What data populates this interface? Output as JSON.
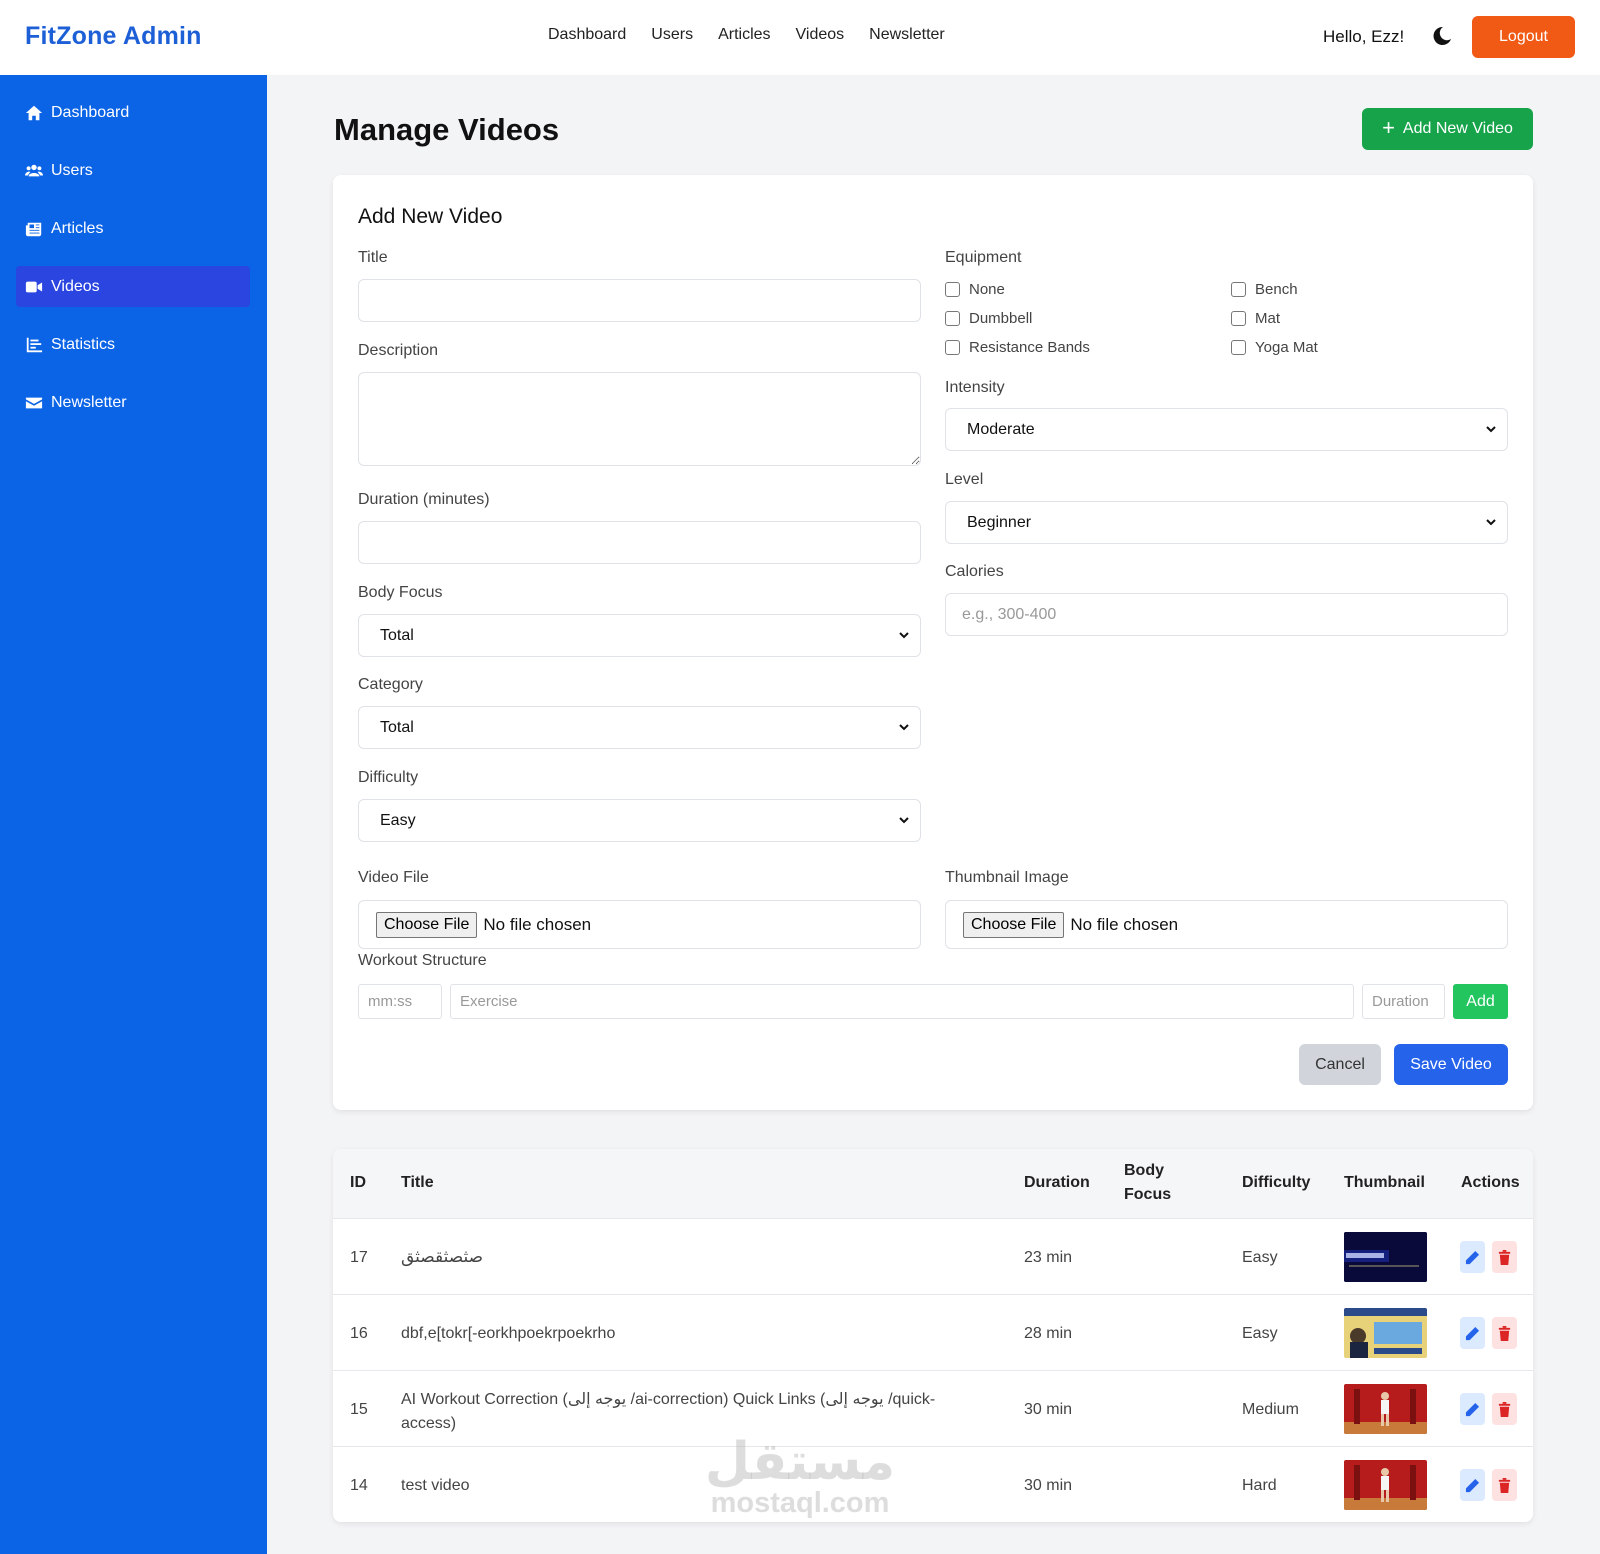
{
  "brand": "FitZone Admin",
  "topnav": [
    "Dashboard",
    "Users",
    "Articles",
    "Videos",
    "Newsletter"
  ],
  "greeting": "Hello, Ezz!",
  "logout_label": "Logout",
  "sidebar": {
    "items": [
      {
        "label": "Dashboard",
        "icon": "home-icon"
      },
      {
        "label": "Users",
        "icon": "users-icon"
      },
      {
        "label": "Articles",
        "icon": "newspaper-icon"
      },
      {
        "label": "Videos",
        "icon": "video-icon",
        "active": true
      },
      {
        "label": "Statistics",
        "icon": "chart-icon"
      },
      {
        "label": "Newsletter",
        "icon": "envelope-icon"
      }
    ]
  },
  "page_title": "Manage Videos",
  "add_new_button": "Add New Video",
  "form": {
    "title": "Add New Video",
    "labels": {
      "title": "Title",
      "description": "Description",
      "duration": "Duration (minutes)",
      "body_focus": "Body Focus",
      "category": "Category",
      "difficulty": "Difficulty",
      "equipment": "Equipment",
      "intensity": "Intensity",
      "level": "Level",
      "calories": "Calories",
      "video_file": "Video File",
      "thumbnail": "Thumbnail Image",
      "workout_structure": "Workout Structure"
    },
    "values": {
      "body_focus": "Total",
      "category": "Total",
      "difficulty": "Easy",
      "intensity": "Moderate",
      "level": "Beginner"
    },
    "calories_placeholder": "e.g., 300-400",
    "equipment": [
      "None",
      "Bench",
      "Dumbbell",
      "Mat",
      "Resistance Bands",
      "Yoga Mat"
    ],
    "file_button": "Choose File",
    "no_file": "No file chosen",
    "ws_time_placeholder": "mm:ss",
    "ws_exercise_placeholder": "Exercise",
    "ws_duration_placeholder": "Duration",
    "ws_add": "Add",
    "cancel": "Cancel",
    "save": "Save Video"
  },
  "table": {
    "headers": {
      "id": "ID",
      "title": "Title",
      "duration": "Duration",
      "body_focus_1": "Body",
      "body_focus_2": "Focus",
      "difficulty": "Difficulty",
      "thumbnail": "Thumbnail",
      "actions": "Actions"
    },
    "rows": [
      {
        "id": "17",
        "title": "صثصثقصثق",
        "duration": "23 min",
        "difficulty": "Easy"
      },
      {
        "id": "16",
        "title": "dbf,e[tokr[-eorkhpoekrpoekrho",
        "duration": "28 min",
        "difficulty": "Easy"
      },
      {
        "id": "15",
        "title": "AI Workout Correction (يوجه إلى /ai-correction) Quick Links (يوجه إلى /quick-access)",
        "duration": "30 min",
        "difficulty": "Medium"
      },
      {
        "id": "14",
        "title": "test video",
        "duration": "30 min",
        "difficulty": "Hard"
      }
    ]
  },
  "watermark": {
    "arabic": "مستقل",
    "latin": "mostaql.com"
  }
}
